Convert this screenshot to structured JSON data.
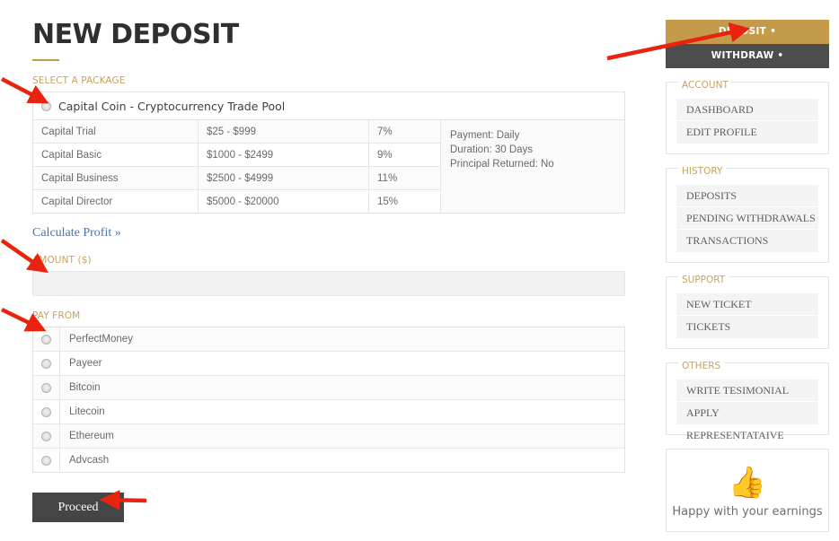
{
  "page": {
    "title": "NEW DEPOSIT"
  },
  "form": {
    "select_package_label": "SELECT A PACKAGE",
    "package_name": "Capital Coin - Cryptocurrency Trade Pool",
    "plans": [
      {
        "name": "Capital Trial",
        "range": "$25 - $999",
        "percent": "7%"
      },
      {
        "name": "Capital Basic",
        "range": "$1000 - $2499",
        "percent": "9%"
      },
      {
        "name": "Capital Business",
        "range": "$2500 - $4999",
        "percent": "11%"
      },
      {
        "name": "Capital Director",
        "range": "$5000 - $20000",
        "percent": "15%"
      }
    ],
    "plan_info": {
      "payment": "Payment: Daily",
      "duration": "Duration: 30 Days",
      "principal": "Principal Returned: No"
    },
    "calculate_profit_link": "Calculate Profit »",
    "amount_label": "AMOUNT ($)",
    "amount_value": "",
    "amount_placeholder": "",
    "pay_from_label": "PAY FROM",
    "payment_methods": [
      "PerfectMoney",
      "Payeer",
      "Bitcoin",
      "Litecoin",
      "Ethereum",
      "Advcash"
    ],
    "proceed_label": "Proceed"
  },
  "sidebar": {
    "deposit_label": "DEPOSIT •",
    "withdraw_label": "WITHDRAW •",
    "groups": [
      {
        "legend": "ACCOUNT",
        "items": [
          "DASHBOARD",
          "EDIT PROFILE"
        ]
      },
      {
        "legend": "HISTORY",
        "items": [
          "DEPOSITS",
          "PENDING WITHDRAWALS",
          "TRANSACTIONS"
        ]
      },
      {
        "legend": "SUPPORT",
        "items": [
          "NEW TICKET",
          "TICKETS"
        ]
      },
      {
        "legend": "OTHERS",
        "items": [
          "WRITE TESIMONIAL",
          "APPLY REPRESENTATAIVE"
        ]
      }
    ],
    "happy_card": {
      "icon": "thumbs-up-icon",
      "text": "Happy with your earnings"
    }
  },
  "colors": {
    "gold": "#c39b4a",
    "gold_label": "#c6a35c",
    "dark": "#4d4d4d",
    "button_dark": "#454545",
    "link_blue": "#4e73a8",
    "annotation_red": "#e8230f"
  }
}
